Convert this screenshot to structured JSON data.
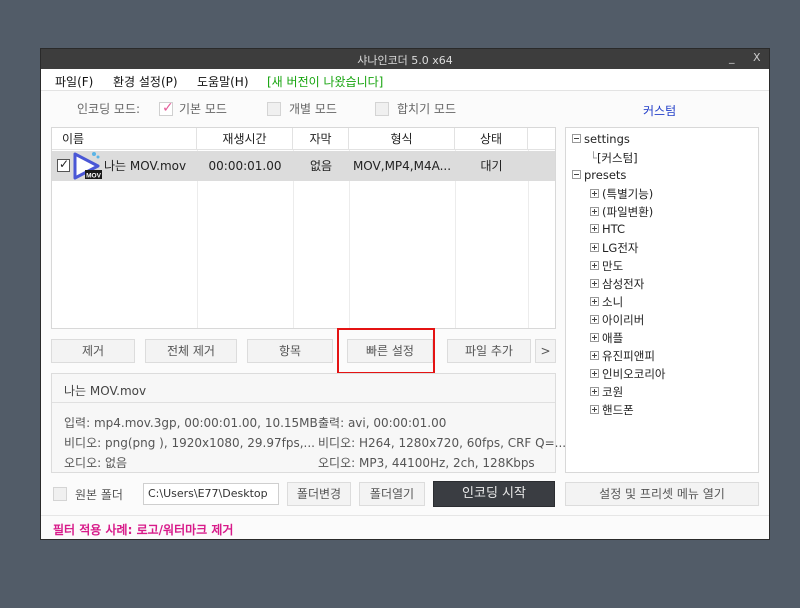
{
  "window": {
    "title": "샤나인코더 5.0 x64",
    "minimize": "_",
    "close": "X"
  },
  "menu": {
    "file": "파일(F)",
    "settings": "환경 설정(P)",
    "help": "도움말(H)",
    "new_version": "[새 버전이 나왔습니다]"
  },
  "modes": {
    "label": "인코딩 모드:",
    "basic": "기본 모드",
    "individual": "개별 모드",
    "merge": "합치기 모드",
    "custom": "커스텀",
    "basic_checked": true
  },
  "table": {
    "headers": [
      "이름",
      "재생시간",
      "자막",
      "형식",
      "상태"
    ],
    "rows": [
      {
        "checked": true,
        "name": "나는 MOV.mov",
        "duration": "00:00:01.00",
        "subtitle": "없음",
        "format": "MOV,MP4,M4A...",
        "status": "대기",
        "icon": "mov-file-icon",
        "icon_badge": "MOV"
      }
    ]
  },
  "buttons": {
    "remove": "제거",
    "remove_all": "전체 제거",
    "item": "항목",
    "quick_settings": "빠른 설정",
    "add_file": "파일 추가",
    "more": ">"
  },
  "info": {
    "filename": "나는 MOV.mov",
    "input": "입력: mp4.mov.3gp, 00:00:01.00, 10.15MB",
    "video_in": "비디오: png(png ), 1920x1080, 29.97fps,...",
    "audio_in": "오디오: 없음",
    "output": "출력: avi, 00:00:01.00",
    "video_out": "비디오: H264, 1280x720, 60fps, CRF Q=...",
    "audio_out": "오디오: MP3, 44100Hz, 2ch, 128Kbps"
  },
  "bottom": {
    "source_folder": "원본 폴더",
    "path": "C:\\Users\\E77\\Desktop",
    "change_folder": "폴더변경",
    "open_folder": "폴더열기",
    "start_encoding": "인코딩 시작",
    "open_presets": "설정 및 프리셋 메뉴 열기"
  },
  "filter": {
    "text": "필터 적용 사례: 로고/워터마크 제거"
  },
  "tree": {
    "settings": "settings",
    "settings_child": "[커스텀]",
    "presets": "presets",
    "children": [
      "(특별기능)",
      "(파일변환)",
      "HTC",
      "LG전자",
      "만도",
      "삼성전자",
      "소니",
      "아이리버",
      "애플",
      "유진피앤피",
      "인비오코리아",
      "코원",
      "핸드폰"
    ]
  },
  "colors": {
    "accent_dark": "#3a3d42",
    "highlight": "#e41313",
    "filter_text": "#d81b8a",
    "new_version": "#17a40f",
    "custom_link": "#2440c9"
  }
}
